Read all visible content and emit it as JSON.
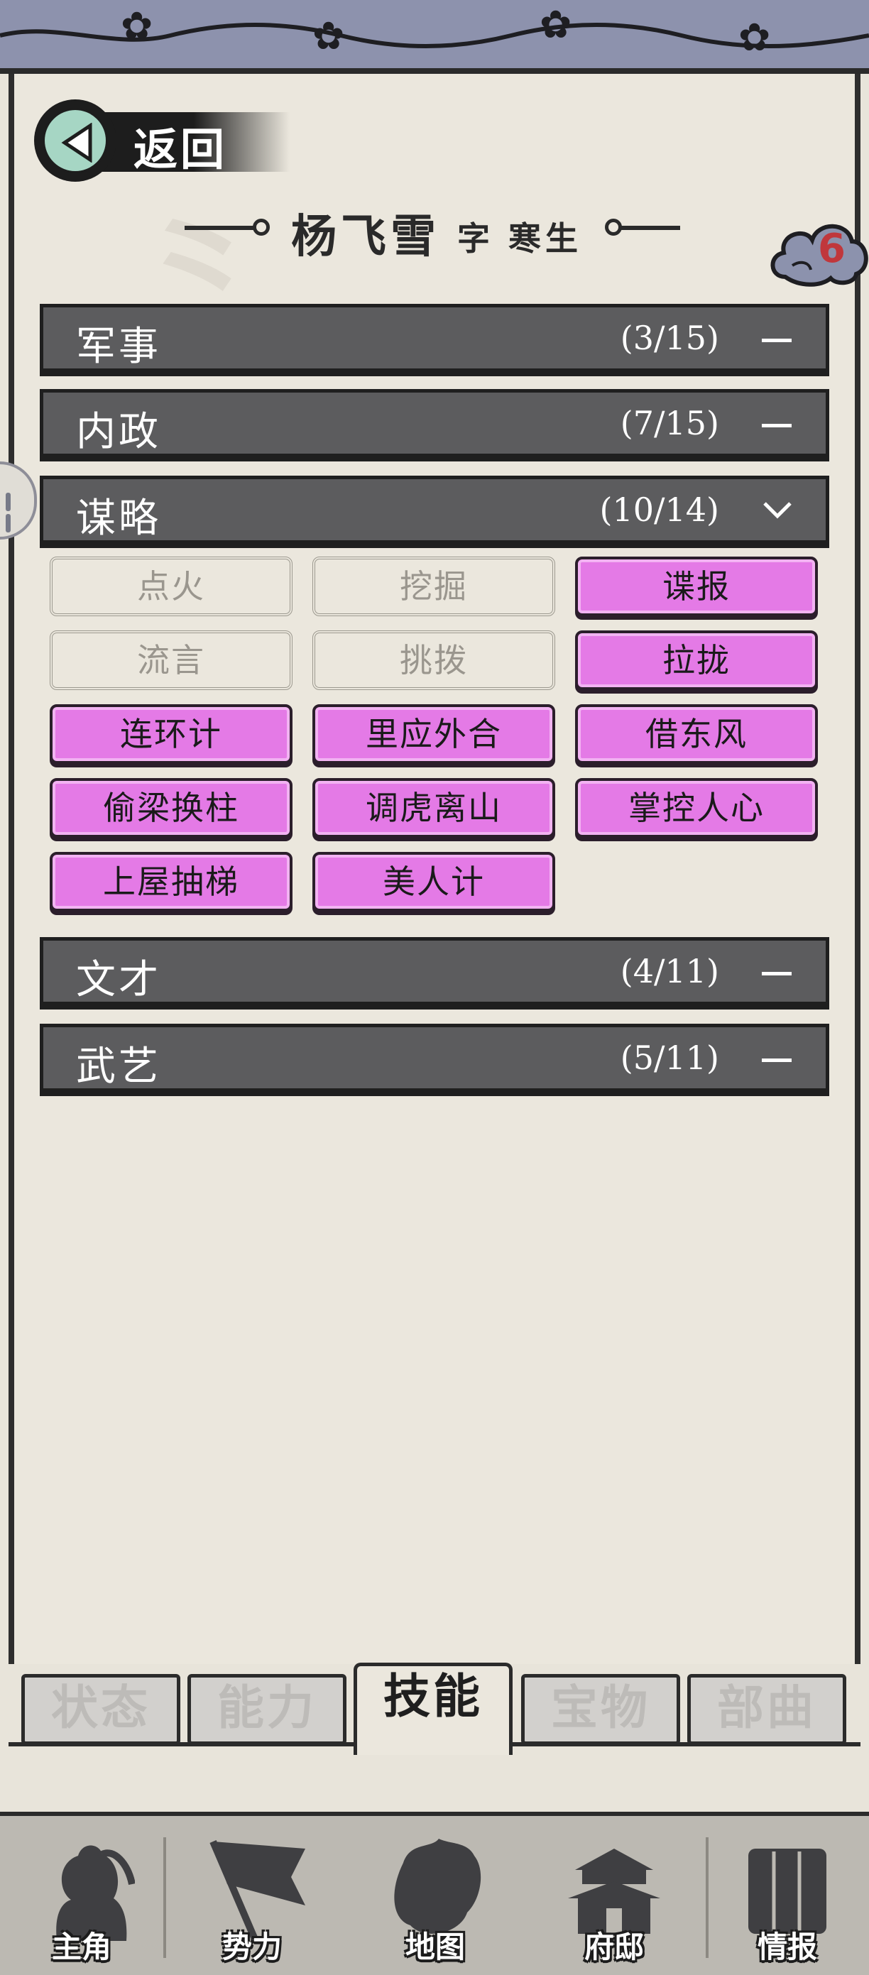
{
  "header": {
    "back_label": "返回",
    "character_name": "杨飞雪",
    "zi_label": "字",
    "style_name": "寒生",
    "badge_count": "6"
  },
  "categories": [
    {
      "name": "军事",
      "count": "(3/15)",
      "state": "collapsed"
    },
    {
      "name": "内政",
      "count": "(7/15)",
      "state": "collapsed"
    },
    {
      "name": "谋略",
      "count": "(10/14)",
      "state": "expanded"
    },
    {
      "name": "文才",
      "count": "(4/11)",
      "state": "collapsed"
    },
    {
      "name": "武艺",
      "count": "(5/11)",
      "state": "collapsed"
    }
  ],
  "skills": [
    {
      "name": "点火",
      "learned": false
    },
    {
      "name": "挖掘",
      "learned": false
    },
    {
      "name": "谍报",
      "learned": true
    },
    {
      "name": "流言",
      "learned": false
    },
    {
      "name": "挑拨",
      "learned": false
    },
    {
      "name": "拉拢",
      "learned": true
    },
    {
      "name": "连环计",
      "learned": true
    },
    {
      "name": "里应外合",
      "learned": true
    },
    {
      "name": "借东风",
      "learned": true
    },
    {
      "name": "偷梁换柱",
      "learned": true
    },
    {
      "name": "调虎离山",
      "learned": true
    },
    {
      "name": "掌控人心",
      "learned": true
    },
    {
      "name": "上屋抽梯",
      "learned": true
    },
    {
      "name": "美人计",
      "learned": true
    }
  ],
  "sub_tabs": [
    {
      "label": "状态",
      "active": false
    },
    {
      "label": "能力",
      "active": false
    },
    {
      "label": "技能",
      "active": true
    },
    {
      "label": "宝物",
      "active": false
    },
    {
      "label": "部曲",
      "active": false
    }
  ],
  "bottom_nav": [
    {
      "label": "主角",
      "icon": "hero-icon",
      "active": false
    },
    {
      "label": "势力",
      "icon": "flag-icon",
      "active": false
    },
    {
      "label": "地图",
      "icon": "map-icon",
      "active": true
    },
    {
      "label": "府邸",
      "icon": "mansion-icon",
      "active": false
    },
    {
      "label": "情报",
      "icon": "scrolls-icon",
      "active": false
    }
  ],
  "colors": {
    "learned_skill": "#e47ae6",
    "category_bar": "#5c5c5e",
    "paper": "#ebe7dd",
    "banner": "#8d92ad",
    "badge_number": "#c0373c"
  }
}
